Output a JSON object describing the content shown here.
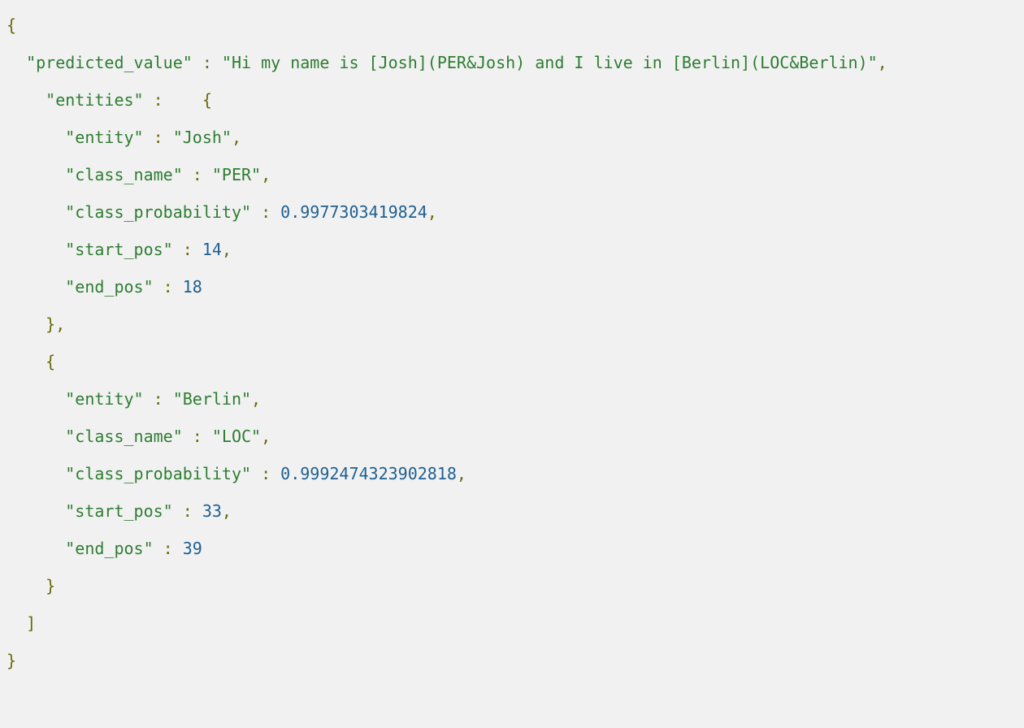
{
  "json_output": {
    "predicted_value_key": "\"predicted_value\"",
    "predicted_value_val": "\"Hi my name is [Josh](PER&Josh) and I live in [Berlin](LOC&Berlin)\"",
    "entities_key": "\"entities\"",
    "entities": [
      {
        "entity_key": "\"entity\"",
        "entity_val": "\"Josh\"",
        "class_name_key": "\"class_name\"",
        "class_name_val": "\"PER\"",
        "class_probability_key": "\"class_probability\"",
        "class_probability_val": "0.9977303419824",
        "start_pos_key": "\"start_pos\"",
        "start_pos_val": "14",
        "end_pos_key": "\"end_pos\"",
        "end_pos_val": "18"
      },
      {
        "entity_key": "\"entity\"",
        "entity_val": "\"Berlin\"",
        "class_name_key": "\"class_name\"",
        "class_name_val": "\"LOC\"",
        "class_probability_key": "\"class_probability\"",
        "class_probability_val": "0.9992474323902818",
        "start_pos_key": "\"start_pos\"",
        "start_pos_val": "33",
        "end_pos_key": "\"end_pos\"",
        "end_pos_val": "39"
      }
    ]
  },
  "tokens": {
    "brace_open": "{",
    "brace_close": "}",
    "bracket_close": "]",
    "colon": " : ",
    "comma": ",",
    "entities_open": " :    {"
  }
}
